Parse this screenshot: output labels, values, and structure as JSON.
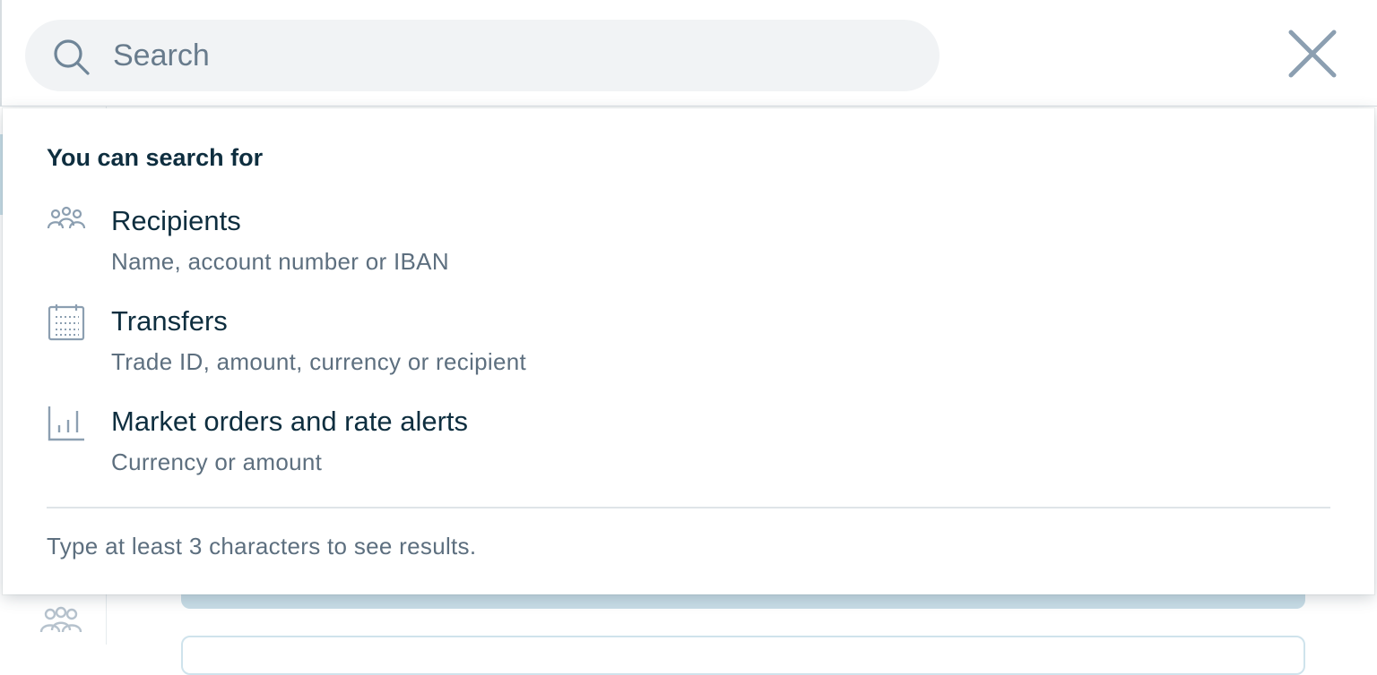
{
  "search": {
    "placeholder": "Search",
    "value": ""
  },
  "close_icon": "close-icon",
  "dropdown": {
    "title": "You can search for",
    "items": [
      {
        "icon": "people-icon",
        "label": "Recipients",
        "description": "Name, account number or IBAN"
      },
      {
        "icon": "calendar-icon",
        "label": "Transfers",
        "description": "Trade ID, amount, currency or recipient"
      },
      {
        "icon": "bar-chart-icon",
        "label": "Market orders and rate alerts",
        "description": "Currency or amount"
      }
    ],
    "footer": "Type at least 3 characters to see results."
  },
  "colors": {
    "text_primary": "#0e2e3f",
    "text_secondary": "#5d6f7f",
    "icon": "#8c9fb1",
    "search_bg": "#f1f3f5",
    "accent_bg": "#c8dde7"
  }
}
